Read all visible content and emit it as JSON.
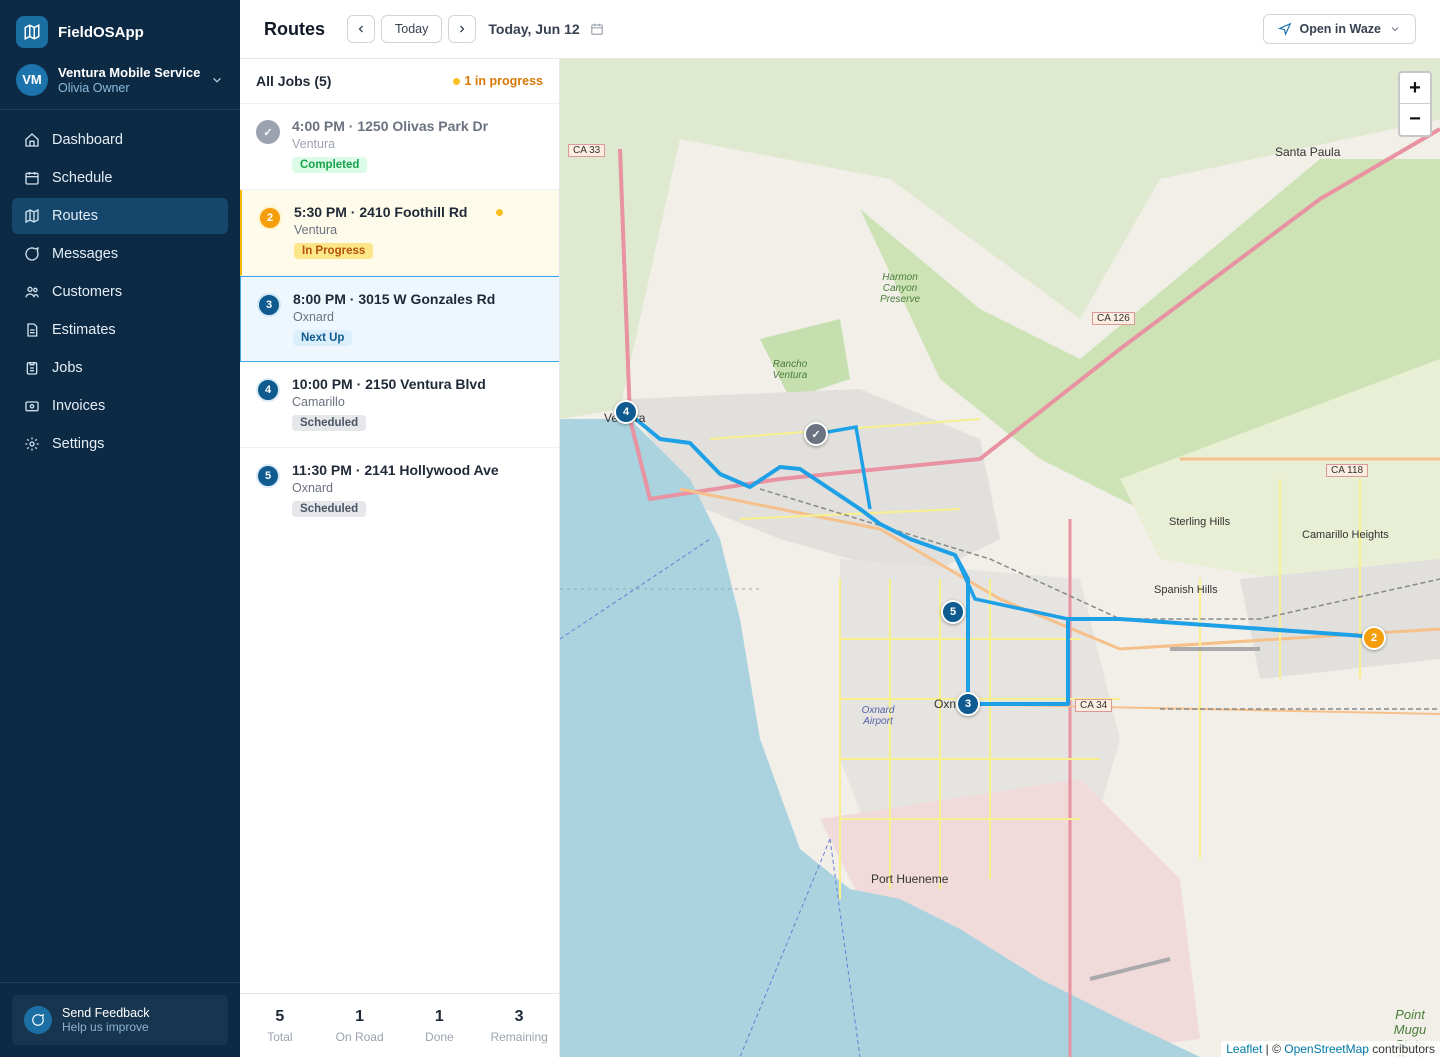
{
  "app": {
    "name": "FieldOSApp"
  },
  "org": {
    "initials": "VM",
    "name": "Ventura Mobile Service",
    "user": "Olivia Owner"
  },
  "nav": [
    {
      "label": "Dashboard",
      "icon": "home-icon"
    },
    {
      "label": "Schedule",
      "icon": "calendar-icon"
    },
    {
      "label": "Routes",
      "icon": "map-icon",
      "active": true
    },
    {
      "label": "Messages",
      "icon": "chat-icon"
    },
    {
      "label": "Customers",
      "icon": "users-icon"
    },
    {
      "label": "Estimates",
      "icon": "document-icon"
    },
    {
      "label": "Jobs",
      "icon": "clipboard-icon"
    },
    {
      "label": "Invoices",
      "icon": "receipt-icon"
    },
    {
      "label": "Settings",
      "icon": "gear-icon"
    }
  ],
  "feedback": {
    "title": "Send Feedback",
    "subtitle": "Help us improve"
  },
  "header": {
    "title": "Routes",
    "today_label": "Today",
    "date_label": "Today, Jun 12",
    "waze_label": "Open in Waze"
  },
  "jobs_panel": {
    "title": "All Jobs (5)",
    "progress_text": "1 in progress",
    "jobs": [
      {
        "num": "✓",
        "title": "4:00 PM · 1250 Olivas Park Dr",
        "city": "Ventura",
        "status": "Completed"
      },
      {
        "num": "2",
        "title": "5:30 PM · 2410 Foothill Rd",
        "city": "Ventura",
        "status": "In Progress"
      },
      {
        "num": "3",
        "title": "8:00 PM · 3015 W Gonzales Rd",
        "city": "Oxnard",
        "status": "Next Up"
      },
      {
        "num": "4",
        "title": "10:00 PM · 2150 Ventura Blvd",
        "city": "Camarillo",
        "status": "Scheduled"
      },
      {
        "num": "5",
        "title": "11:30 PM · 2141 Hollywood Ave",
        "city": "Oxnard",
        "status": "Scheduled"
      }
    ],
    "stats": [
      {
        "value": "5",
        "label": "Total"
      },
      {
        "value": "1",
        "label": "On Road"
      },
      {
        "value": "1",
        "label": "Done"
      },
      {
        "value": "3",
        "label": "Remaining"
      }
    ]
  },
  "map": {
    "zoom_in": "+",
    "zoom_out": "−",
    "attribution_leaflet": "Leaflet",
    "attribution_sep": " | © ",
    "attribution_osm": "OpenStreetMap",
    "attribution_tail": " contributors",
    "places": [
      "Santa Paula",
      "Sterling Hills",
      "Camarillo Heights",
      "Spanish Hills",
      "Port Hueneme",
      "Ventura",
      "Oxnard"
    ],
    "park_labels": [
      "Harmon Canyon Preserve",
      "Rancho Ventura",
      "Oxnard Airport",
      "Point Mugu State Park"
    ],
    "shields": [
      "CA 33",
      "CA 126",
      "CA 118",
      "CA 34"
    ],
    "pins": [
      "4",
      "✓",
      "5",
      "3",
      "2"
    ],
    "colors": {
      "route": "#1ea0e6",
      "water": "#aad3df",
      "land": "#f2efe9"
    }
  }
}
